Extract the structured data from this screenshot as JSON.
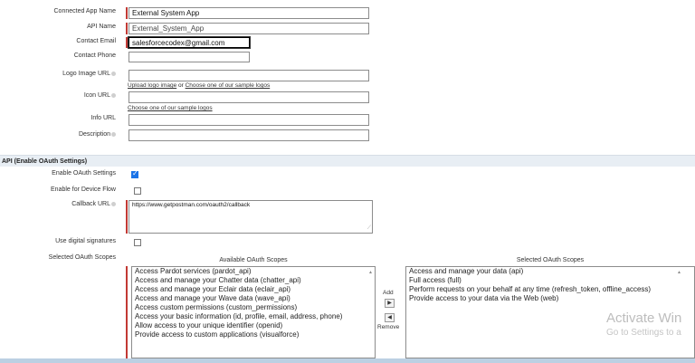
{
  "form": {
    "connected_app_name": {
      "label": "Connected App Name",
      "value": "External System App"
    },
    "api_name": {
      "label": "API Name",
      "value": "External_System_App"
    },
    "contact_email": {
      "label": "Contact Email",
      "value": "salesforcecodex@gmail.com"
    },
    "contact_phone": {
      "label": "Contact Phone",
      "value": ""
    },
    "logo_image_url": {
      "label": "Logo Image URL",
      "value": "",
      "link_upload": "Upload logo image",
      "link_or": "or",
      "link_choose": "Choose one of our sample logos"
    },
    "icon_url": {
      "label": "Icon URL",
      "value": "",
      "link_choose": "Choose one of our sample logos"
    },
    "info_url": {
      "label": "Info URL",
      "value": ""
    },
    "description": {
      "label": "Description",
      "value": ""
    }
  },
  "oauth": {
    "section_title": "API (Enable OAuth Settings)",
    "enable_oauth": {
      "label": "Enable OAuth Settings",
      "checked": true
    },
    "device_flow": {
      "label": "Enable for Device Flow",
      "checked": false
    },
    "callback_url": {
      "label": "Callback URL",
      "value": "https://www.getpostman.com/oauth2/callback"
    },
    "digital_signatures": {
      "label": "Use digital signatures",
      "checked": false
    },
    "selected_scopes_label": "Selected OAuth Scopes",
    "available_heading": "Available OAuth Scopes",
    "selected_heading": "Selected OAuth Scopes",
    "add_label": "Add",
    "remove_label": "Remove",
    "available": [
      "Access Pardot services (pardot_api)",
      "Access and manage your Chatter data (chatter_api)",
      "Access and manage your Eclair data (eclair_api)",
      "Access and manage your Wave data (wave_api)",
      "Access custom permissions (custom_permissions)",
      "Access your basic information (id, profile, email, address, phone)",
      "Allow access to your unique identifier (openid)",
      "Provide access to custom applications (visualforce)"
    ],
    "selected": [
      "Access and manage your data (api)",
      "Full access (full)",
      "Perform requests on your behalf at any time (refresh_token, offline_access)",
      "Provide access to your data via the Web (web)"
    ]
  },
  "watermark": {
    "line1": "Activate Win",
    "line2": "Go to Settings to a"
  },
  "colors": {
    "required": "#c23934",
    "checkbox_on": "#1a73e8",
    "section_bg": "#e8eef4"
  }
}
